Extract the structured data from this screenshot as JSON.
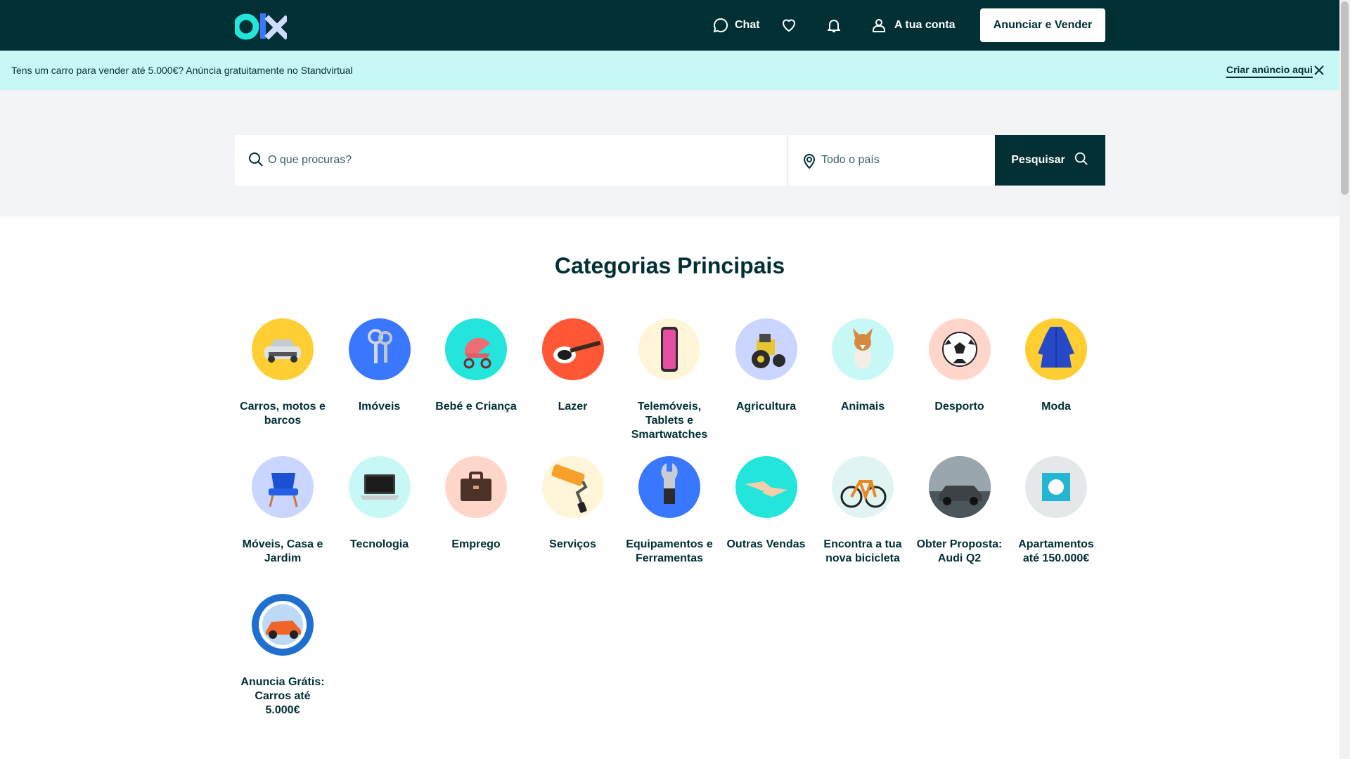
{
  "header": {
    "chat_label": "Chat",
    "account_label": "A tua conta",
    "sell_button": "Anunciar e Vender"
  },
  "banner": {
    "text": "Tens um carro para vender até 5.000€? Anúncia gratuitamente no Standvirtual",
    "link": "Criar anúncio aqui"
  },
  "search": {
    "placeholder": "O que procuras?",
    "location_placeholder": "Todo o país",
    "button": "Pesquisar"
  },
  "categories_title": "Categorias Principais",
  "categories": [
    {
      "label": "Carros, motos e barcos",
      "color": "#ffce32",
      "icon": "car-icon"
    },
    {
      "label": "Imóveis",
      "color": "#3a77ff",
      "icon": "keys-icon"
    },
    {
      "label": "Bebé e Criança",
      "color": "#23e5db",
      "icon": "stroller-icon"
    },
    {
      "label": "Lazer",
      "color": "#ff5636",
      "icon": "guitar-icon"
    },
    {
      "label": "Telemóveis, Tablets e Smartwatches",
      "color": "#fff6d9",
      "icon": "phone-icon"
    },
    {
      "label": "Agricultura",
      "color": "#cad6ff",
      "icon": "tractor-icon"
    },
    {
      "label": "Animais",
      "color": "#c8f8f6",
      "icon": "dog-icon"
    },
    {
      "label": "Desporto",
      "color": "#ffd6c9",
      "icon": "football-icon"
    },
    {
      "label": "Moda",
      "color": "#ffce32",
      "icon": "dress-icon"
    },
    {
      "label": "Móveis, Casa e Jardim",
      "color": "#cad6ff",
      "icon": "chair-icon"
    },
    {
      "label": "Tecnologia",
      "color": "#c8f8f6",
      "icon": "laptop-icon"
    },
    {
      "label": "Emprego",
      "color": "#ffd6c9",
      "icon": "briefcase-icon"
    },
    {
      "label": "Serviços",
      "color": "#fff6d9",
      "icon": "paint-roller-icon"
    },
    {
      "label": "Equipamentos e Ferramentas",
      "color": "#3a77ff",
      "icon": "wrench-icon"
    },
    {
      "label": "Outras Vendas",
      "color": "#23e5db",
      "icon": "handshake-icon"
    },
    {
      "label": "Encontra a tua nova bicicleta",
      "color": "#e0f5f3",
      "icon": "bicycle-icon"
    },
    {
      "label": "Obter Proposta: Audi Q2",
      "color": "#5d6b73",
      "icon": "audi-car-icon"
    },
    {
      "label": "Apartamentos até 150.000€",
      "color": "#e5e8e9",
      "icon": "apartment-icon"
    },
    {
      "label": "Anuncia Grátis: Carros até 5.000€",
      "color": "#1f6fd1",
      "icon": "standvirtual-car-icon"
    }
  ]
}
